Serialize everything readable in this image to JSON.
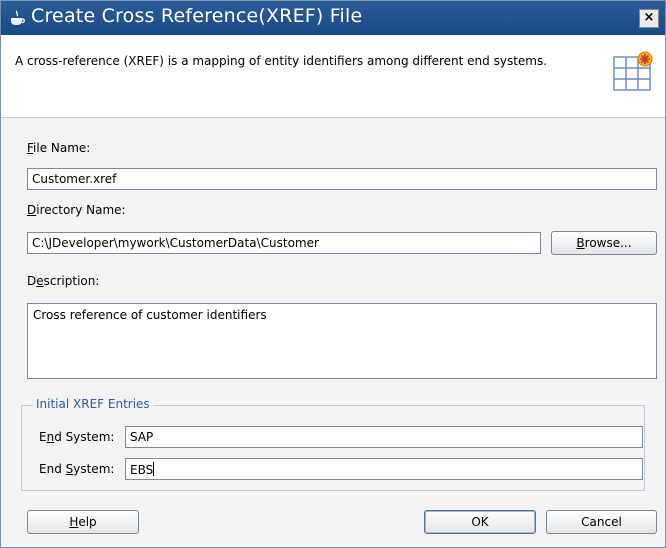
{
  "dialog": {
    "title": "Create Cross Reference(XREF) File",
    "close_label": "×",
    "description": "A cross-reference (XREF) is a mapping of entity identifiers among different end systems."
  },
  "form": {
    "file_name": {
      "label_mnemonic": "F",
      "label_rest": "ile Name:",
      "value": "Customer.xref"
    },
    "directory_name": {
      "label_mnemonic": "D",
      "label_rest": "irectory Name:",
      "value": "C:\\JDeveloper\\mywork\\CustomerData\\Customer"
    },
    "browse": {
      "label_mnemonic": "B",
      "label_rest": "rowse..."
    },
    "description": {
      "label_pre": "D",
      "label_mnemonic": "e",
      "label_rest": "scription:",
      "value": "Cross reference of customer identifiers"
    }
  },
  "xref_group": {
    "title": "Initial XREF Entries",
    "entries": [
      {
        "label_pre": "E",
        "label_mnemonic": "n",
        "label_rest": "d System:",
        "value": "SAP"
      },
      {
        "label_pre": "End ",
        "label_mnemonic": "S",
        "label_rest": "ystem:",
        "value": "EBS"
      }
    ]
  },
  "buttons": {
    "help": {
      "label_mnemonic": "H",
      "label_rest": "elp"
    },
    "ok": "OK",
    "cancel": "Cancel"
  },
  "colors": {
    "titlebar": "#1f548f",
    "group_title": "#2d5ca0",
    "grid_icon_star": "#f2b51a"
  },
  "icons": {
    "title": "coffee-cup-icon",
    "banner": "grid-star-icon"
  }
}
